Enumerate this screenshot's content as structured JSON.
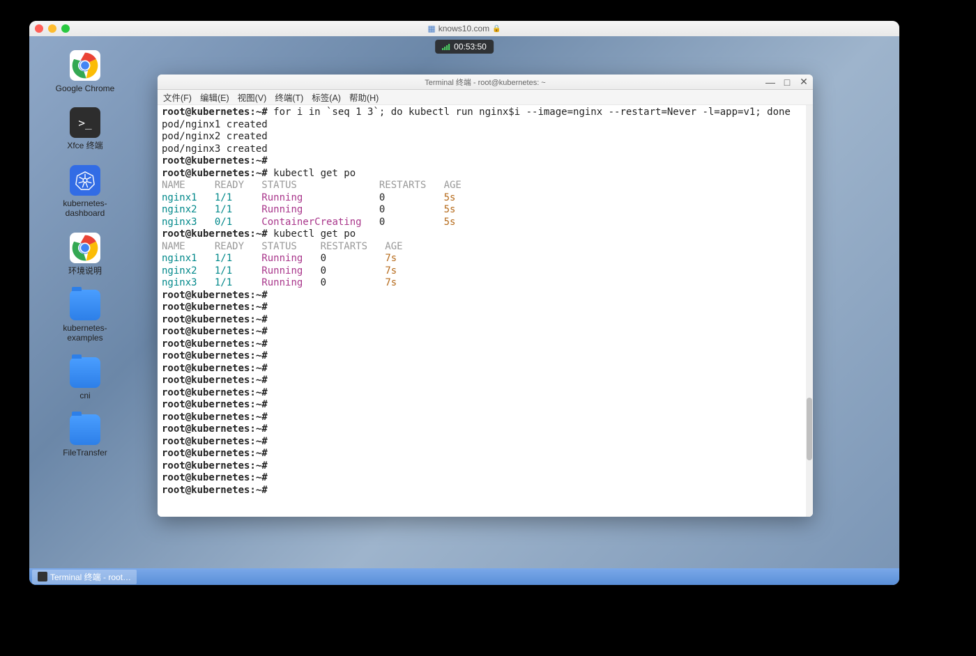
{
  "mac": {
    "url": "knows10.com"
  },
  "timer": "00:53:50",
  "desktop_icons": [
    {
      "label": "Google Chrome",
      "type": "chrome"
    },
    {
      "label": "Xfce 终端",
      "type": "terminal"
    },
    {
      "label": "kubernetes-dashboard",
      "type": "k8s"
    },
    {
      "label": "环境说明",
      "type": "chrome"
    },
    {
      "label": "kubernetes-examples",
      "type": "folder"
    },
    {
      "label": "cni",
      "type": "folder"
    },
    {
      "label": "FileTransfer",
      "type": "folder"
    }
  ],
  "taskbar": {
    "item": "Terminal 终端 - root…"
  },
  "terminal": {
    "title": "Terminal 终端 - root@kubernetes: ~",
    "menu": [
      "文件(F)",
      "编辑(E)",
      "视图(V)",
      "终端(T)",
      "标签(A)",
      "帮助(H)"
    ],
    "prompt": "root@kubernetes:~#",
    "cmd1": "for i in `seq 1 3`; do kubectl run nginx$i --image=nginx --restart=Never -l=app=v1; done",
    "created1": "pod/nginx1 created",
    "created2": "pod/nginx2 created",
    "created3": "pod/nginx3 created",
    "cmd2": "kubectl get po",
    "header1": {
      "name": "NAME",
      "ready": "READY",
      "status": "STATUS",
      "restarts": "RESTARTS",
      "age": "AGE"
    },
    "rows1": [
      {
        "name": "nginx1",
        "ready": "1/1",
        "status": "Running",
        "restarts": "0",
        "age": "5s"
      },
      {
        "name": "nginx2",
        "ready": "1/1",
        "status": "Running",
        "restarts": "0",
        "age": "5s"
      },
      {
        "name": "nginx3",
        "ready": "0/1",
        "status": "ContainerCreating",
        "restarts": "0",
        "age": "5s"
      }
    ],
    "header2": {
      "name": "NAME",
      "ready": "READY",
      "status": "STATUS",
      "restarts": "RESTARTS",
      "age": "AGE"
    },
    "rows2": [
      {
        "name": "nginx1",
        "ready": "1/1",
        "status": "Running",
        "restarts": "0",
        "age": "7s"
      },
      {
        "name": "nginx2",
        "ready": "1/1",
        "status": "Running",
        "restarts": "0",
        "age": "7s"
      },
      {
        "name": "nginx3",
        "ready": "1/1",
        "status": "Running",
        "restarts": "0",
        "age": "7s"
      }
    ],
    "empty_prompts": 17
  }
}
